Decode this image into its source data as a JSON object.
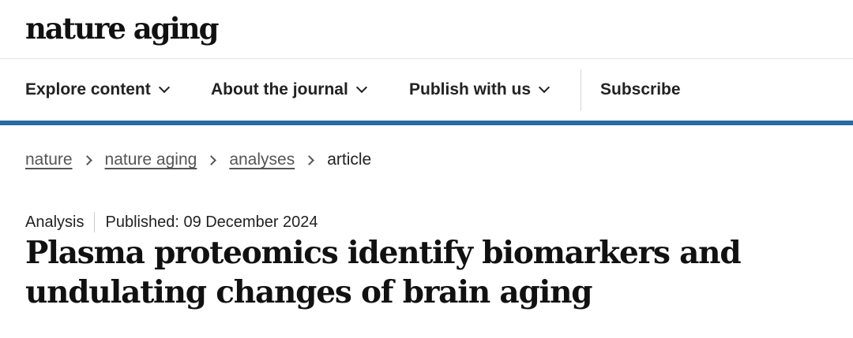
{
  "site": {
    "logo_text": "nature aging"
  },
  "nav": {
    "items": [
      {
        "label": "Explore content",
        "has_dropdown": true
      },
      {
        "label": "About the journal",
        "has_dropdown": true
      },
      {
        "label": "Publish with us",
        "has_dropdown": true
      }
    ],
    "subscribe_label": "Subscribe"
  },
  "breadcrumb": {
    "links": [
      "nature",
      "nature aging",
      "analyses"
    ],
    "current": "article"
  },
  "article": {
    "type": "Analysis",
    "published": "Published: 09 December 2024",
    "title_line1": "Plasma proteomics identify biomarkers and",
    "title_line2": "undulating changes of brain aging"
  },
  "colors": {
    "nav_rule": "#2b6aa3",
    "text": "#222222"
  },
  "icons": [
    "chevron-down-icon",
    "chevron-right-icon"
  ]
}
